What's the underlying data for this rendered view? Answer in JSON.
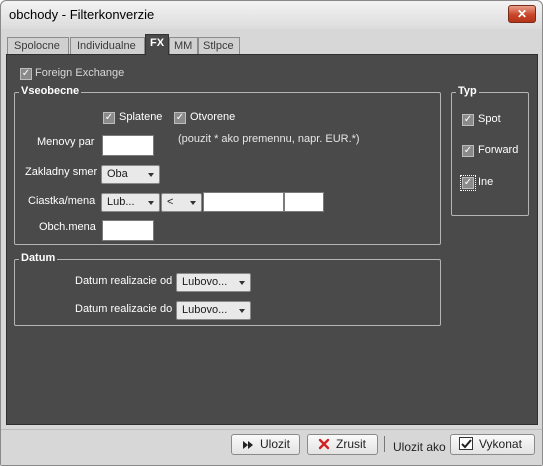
{
  "window": {
    "title": "obchody - Filterkonverzie",
    "close_glyph": "✕"
  },
  "tabs": [
    {
      "label": "Spolocne"
    },
    {
      "label": "Individualne"
    },
    {
      "label": "FX"
    },
    {
      "label": "MM"
    },
    {
      "label": "Stlpce"
    }
  ],
  "foreign_exchange": {
    "label": "Foreign Exchange",
    "checked": true
  },
  "vseobecne": {
    "title": "Vseobecne",
    "splatene": {
      "label": "Splatene",
      "checked": true
    },
    "otvorene": {
      "label": "Otvorene",
      "checked": true
    },
    "menovy_par": {
      "label": "Menovy par",
      "value": ""
    },
    "hint": "(pouzit * ako premennu, napr. EUR.*)",
    "zakladny_smer": {
      "label": "Zakladny smer",
      "value": "Oba"
    },
    "ciastka_mena": {
      "label": "Ciastka/mena",
      "combo": "Lub...",
      "operator": "<",
      "amount": "",
      "currency": ""
    },
    "obch_mena": {
      "label": "Obch.mena",
      "value": ""
    }
  },
  "datum": {
    "title": "Datum",
    "od": {
      "label": "Datum realizacie od",
      "value": "Lubovo..."
    },
    "do": {
      "label": "Datum realizacie do",
      "value": "Lubovo..."
    }
  },
  "typ": {
    "title": "Typ",
    "spot": {
      "label": "Spot",
      "checked": true
    },
    "forward": {
      "label": "Forward",
      "checked": true
    },
    "ine": {
      "label": "Ine",
      "checked": true
    }
  },
  "footer": {
    "ulozit": "Ulozit",
    "zrusit": "Zrusit",
    "ulozit_ako": "Ulozit ako",
    "vykonat": "Vykonat"
  },
  "check_glyph": "✓",
  "colors": {
    "panel": "#4a4a4a",
    "close_button": "#c9452a",
    "cancel_icon": "#d42020"
  }
}
